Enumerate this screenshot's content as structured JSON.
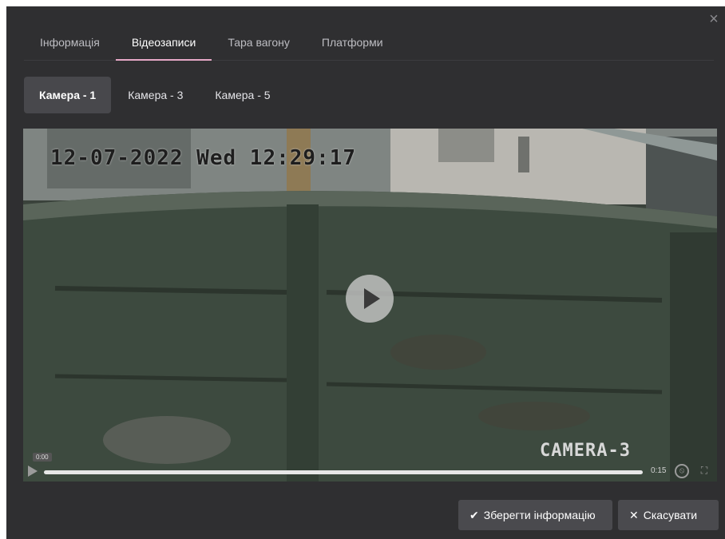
{
  "dialog": {
    "close_glyph": "×"
  },
  "main_tabs": [
    {
      "label": "Інформація",
      "active": false
    },
    {
      "label": "Відеозаписи",
      "active": true
    },
    {
      "label": "Тара вагону",
      "active": false
    },
    {
      "label": "Платформи",
      "active": false
    }
  ],
  "camera_tabs": [
    {
      "label": "Камера - 1",
      "active": true
    },
    {
      "label": "Камера - 3",
      "active": false
    },
    {
      "label": "Камера - 5",
      "active": false
    }
  ],
  "video": {
    "osd_timestamp": "12-07-2022 Wed 12:29:17",
    "osd_camera": "CAMERA-3",
    "current_time": "0:00",
    "duration": "0:15",
    "progress_fraction": 0.0
  },
  "buttons": {
    "save_label": "Зберегти інформацію",
    "save_icon": "checkmark-icon",
    "save_glyph": "✔",
    "cancel_label": "Скасувати",
    "cancel_icon": "close-icon",
    "cancel_glyph": "✕"
  },
  "colors": {
    "dialog_bg": "#2f2f31",
    "active_tab_underline": "#e6a8c6",
    "button_bg": "#4a4a4e"
  }
}
